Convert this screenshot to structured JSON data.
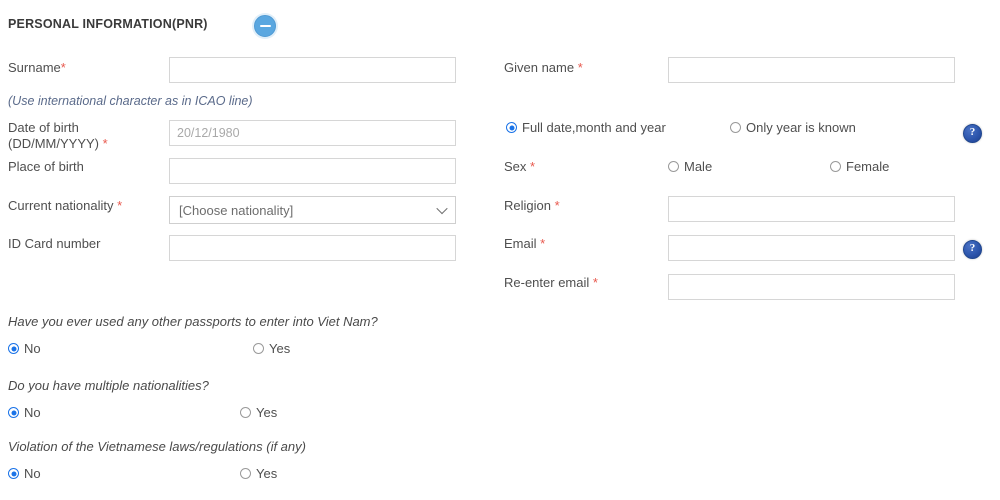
{
  "section": {
    "title": "PERSONAL INFORMATION(PNR)",
    "collapse_icon": "minus-circle-icon"
  },
  "fields": {
    "surname": {
      "label": "Surname",
      "required": true,
      "value": "",
      "placeholder": ""
    },
    "surname_hint": "(Use international character as in ICAO line)",
    "given_name": {
      "label": "Given name",
      "required": true,
      "value": "",
      "placeholder": ""
    },
    "date_of_birth": {
      "label_line1": "Date of birth",
      "label_line2": "(DD/MM/YYYY)",
      "required": true,
      "value": "",
      "placeholder": "20/12/1980"
    },
    "place_of_birth": {
      "label": "Place of birth",
      "required": false,
      "value": "",
      "placeholder": ""
    },
    "current_nationality": {
      "label": "Current nationality",
      "required": true,
      "selected": "[Choose nationality]"
    },
    "id_card_number": {
      "label": "ID Card number",
      "required": false,
      "value": "",
      "placeholder": ""
    },
    "religion": {
      "label": "Religion",
      "required": true,
      "value": "",
      "placeholder": ""
    },
    "email": {
      "label": "Email",
      "required": true,
      "value": "",
      "placeholder": ""
    },
    "reenter_email": {
      "label": "Re-enter email",
      "required": true,
      "value": "",
      "placeholder": ""
    },
    "sex": {
      "label": "Sex",
      "required": true
    }
  },
  "dob_mode": {
    "options": [
      {
        "label": "Full date,month and year",
        "checked": true
      },
      {
        "label": "Only year is known",
        "checked": false
      }
    ]
  },
  "sex_options": [
    {
      "label": "Male",
      "checked": false
    },
    {
      "label": "Female",
      "checked": false
    }
  ],
  "questions": [
    {
      "text": "Have you ever used any other passports to enter into Viet Nam?",
      "options": [
        {
          "label": "No",
          "checked": true
        },
        {
          "label": "Yes",
          "checked": false
        }
      ]
    },
    {
      "text": "Do you have multiple nationalities?",
      "options": [
        {
          "label": "No",
          "checked": true
        },
        {
          "label": "Yes",
          "checked": false
        }
      ]
    },
    {
      "text": "Violation of the Vietnamese laws/regulations (if any)",
      "options": [
        {
          "label": "No",
          "checked": true
        },
        {
          "label": "Yes",
          "checked": false
        }
      ]
    }
  ],
  "help_icons": {
    "dob_help": "?",
    "email_help": "?"
  },
  "colors": {
    "required_asterisk": "#e8584d",
    "radio_checked": "#1a73e8",
    "collapse_button": "#5aa7e0",
    "help_button": "#2d56ad",
    "hint_text": "#5a6a8a",
    "heading": "#3a3a3a"
  }
}
